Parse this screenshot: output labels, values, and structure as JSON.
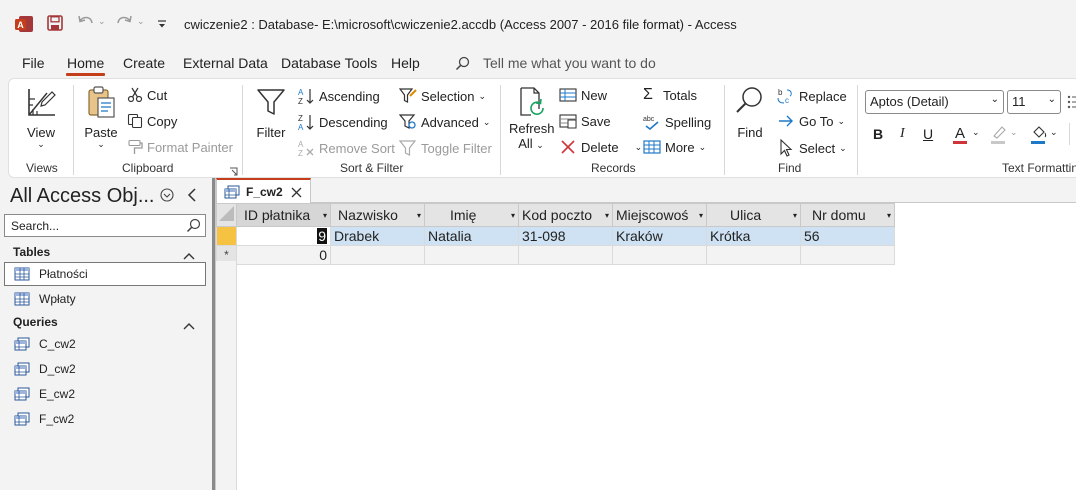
{
  "title": {
    "text": "cwiczenie2 : Database- E:\\microsoft\\cwiczenie2.accdb (Access 2007 - 2016 file format)  -  Access"
  },
  "menu": {
    "tabs": [
      "File",
      "Home",
      "Create",
      "External Data",
      "Database Tools",
      "Help"
    ],
    "active": "Home",
    "tell_me": "Tell me what you want to do"
  },
  "ribbon": {
    "views": {
      "view": "View",
      "group": "Views"
    },
    "clipboard": {
      "paste": "Paste",
      "cut": "Cut",
      "copy": "Copy",
      "format_painter": "Format Painter",
      "group": "Clipboard"
    },
    "sort_filter": {
      "filter": "Filter",
      "ascending": "Ascending",
      "descending": "Descending",
      "remove_sort": "Remove Sort",
      "selection": "Selection",
      "advanced": "Advanced",
      "toggle_filter": "Toggle Filter",
      "group": "Sort & Filter"
    },
    "records": {
      "refresh_line1": "Refresh",
      "refresh_line2": "All",
      "new": "New",
      "save": "Save",
      "delete": "Delete",
      "totals": "Totals",
      "spelling": "Spelling",
      "more": "More",
      "group": "Records"
    },
    "find": {
      "find": "Find",
      "replace": "Replace",
      "goto": "Go To",
      "select": "Select",
      "group": "Find"
    },
    "text": {
      "font": "Aptos (Detail)",
      "size": "11",
      "bold": "B",
      "italic": "I",
      "underline": "U",
      "font_color_letter": "A",
      "group": "Text Formattin"
    }
  },
  "nav": {
    "title": "All Access Obj...",
    "search_placeholder": "Search...",
    "sections": [
      {
        "name": "Tables",
        "items": [
          "Płatności",
          "Wpłaty"
        ]
      },
      {
        "name": "Queries",
        "items": [
          "C_cw2",
          "D_cw2",
          "E_cw2",
          "F_cw2"
        ]
      }
    ]
  },
  "document": {
    "tab": "F_cw2",
    "columns": [
      "ID płatnika",
      "Nazwisko",
      "Imię",
      "Kod poczto",
      "Miejscowoś",
      "Ulica",
      "Nr domu"
    ],
    "rows": [
      [
        "9",
        "Drabek",
        "Natalia",
        "31-098",
        "Kraków",
        "Krótka",
        "56"
      ]
    ],
    "new_row": {
      "marker": "*",
      "id": "0"
    }
  },
  "colors": {
    "accent": "#c43e1c",
    "selected_row": "#cfe2f3",
    "active_tab_underline": "#c43e1c"
  }
}
